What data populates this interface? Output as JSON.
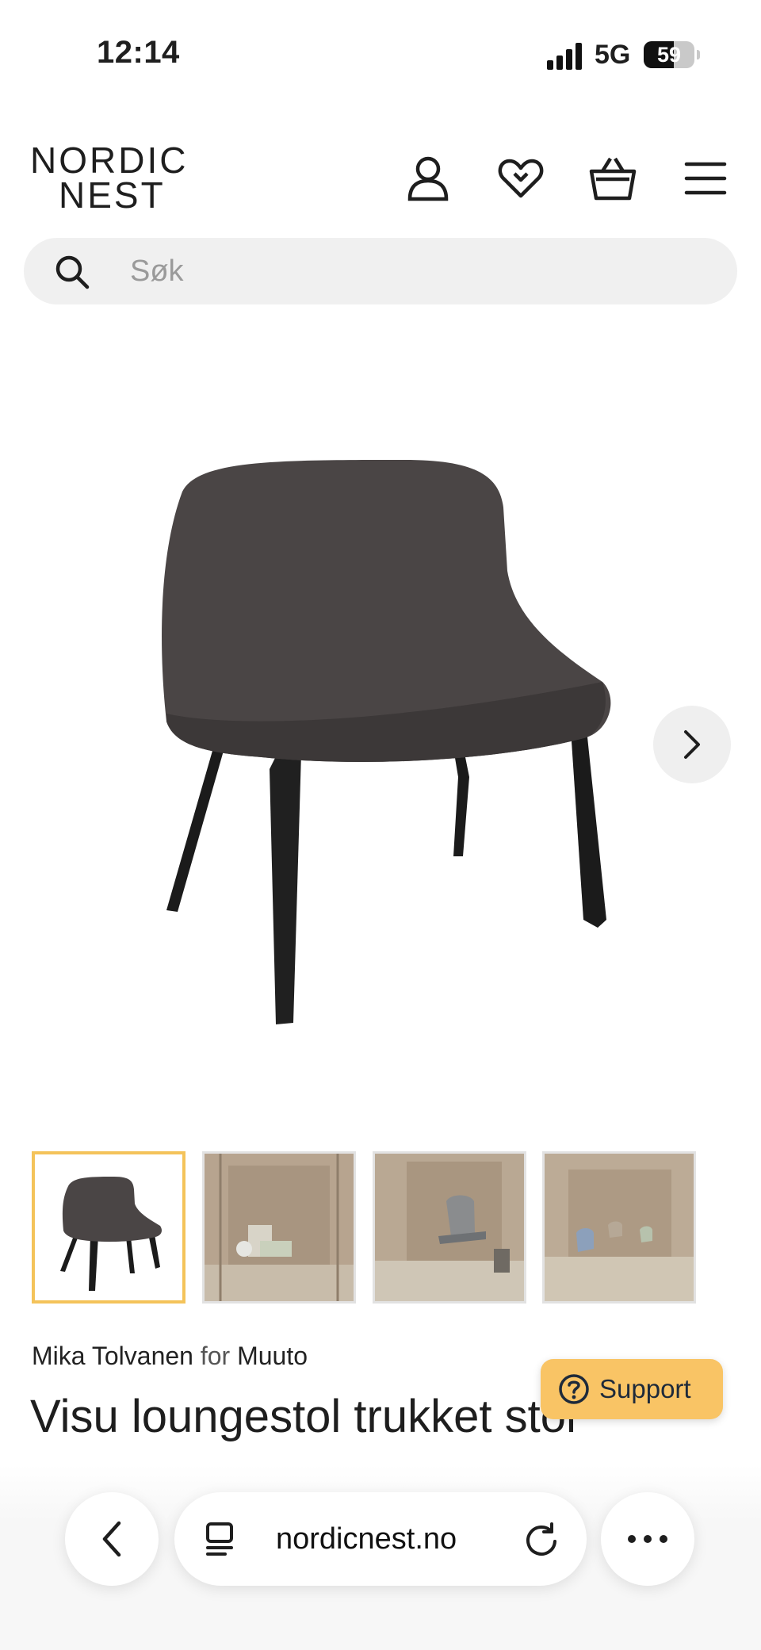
{
  "status_bar": {
    "time": "12:14",
    "network": "5G",
    "battery": "59",
    "battery_level": 0.59
  },
  "header": {
    "logo_line1": "NORDIC",
    "logo_line2": "NEST",
    "icons": [
      "user-icon",
      "heart-icon",
      "basket-icon",
      "menu-icon"
    ]
  },
  "search": {
    "placeholder": "Søk"
  },
  "gallery": {
    "thumbnails": [
      "chair-product-thumb",
      "room-scene-thumb",
      "room-scene-thumb",
      "room-scene-thumb"
    ],
    "selected_index": 0
  },
  "product": {
    "designer": "Mika Tolvanen",
    "connector": "for",
    "brand": "Muuto",
    "title": "Visu loungestol trukket stol"
  },
  "support": {
    "label": "Support"
  },
  "browser": {
    "url": "nordicnest.no"
  },
  "colors": {
    "accent": "#f4c35a",
    "support_bg": "#f9c465",
    "search_bg": "#f0f0f0"
  }
}
